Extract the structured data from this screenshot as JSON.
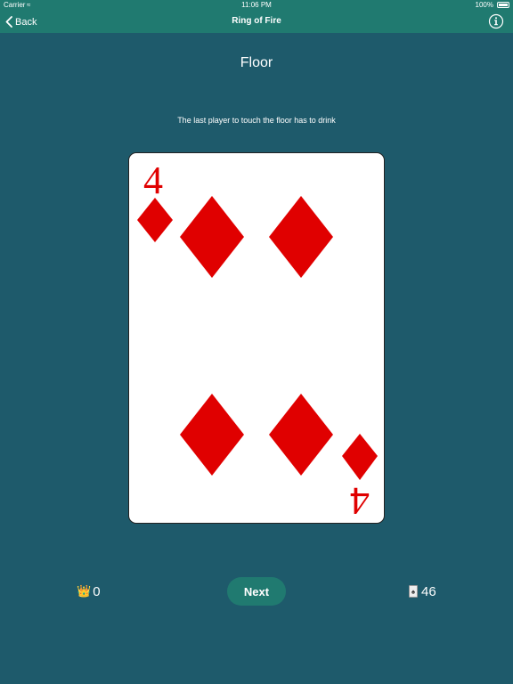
{
  "status_bar": {
    "carrier": "Carrier",
    "time": "11:06 PM",
    "battery": "100%"
  },
  "nav": {
    "back_label": "Back",
    "title": "Ring of Fire"
  },
  "card": {
    "title": "Floor",
    "rule": "The last player to touch the floor has to drink",
    "rank": "4",
    "suit": "diamonds",
    "suit_color": "#e00000"
  },
  "footer": {
    "crown_count": "0",
    "next_label": "Next",
    "cards_remaining": "46"
  },
  "colors": {
    "background": "#1e5a6b",
    "bar": "#207a70",
    "button": "#207a70"
  },
  "icons": {
    "back": "chevron-left-icon",
    "info": "info-circle-icon",
    "crown": "crown-icon",
    "deck": "card-deck-icon"
  }
}
